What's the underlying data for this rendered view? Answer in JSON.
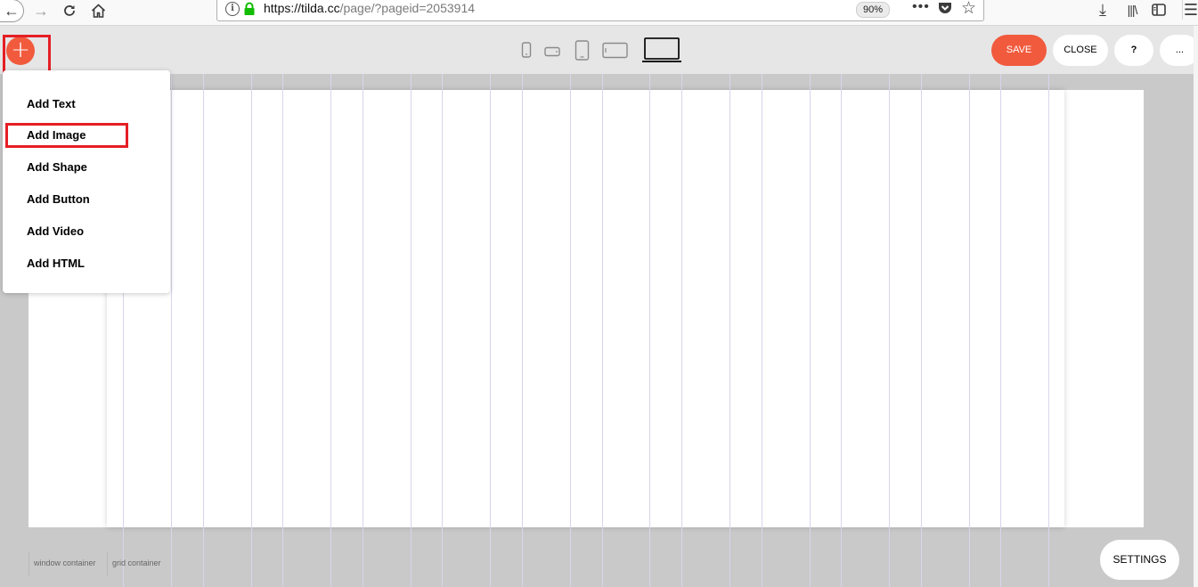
{
  "browser": {
    "url_domain": "https://tilda.cc",
    "url_path": "/page/?pageid=2053914",
    "zoom": "90%",
    "more_glyph": "•••"
  },
  "toolbar": {
    "add_glyph": "+",
    "save_label": "SAVE",
    "close_label": "CLOSE",
    "help_label": "?",
    "more_label": "..."
  },
  "add_menu": {
    "items": [
      "Add Text",
      "Add Image",
      "Add Shape",
      "Add Button",
      "Add Video",
      "Add HTML"
    ]
  },
  "footer": {
    "window_container_label": "window container",
    "grid_container_label": "grid container",
    "settings_label": "SETTINGS"
  },
  "colors": {
    "accent": "#f15a3d",
    "highlight": "#e51e25",
    "workspace": "#c9c9c9",
    "toolbar": "#e6e6e6",
    "grid_line": "#d6d6ec"
  },
  "icons": {
    "devices": [
      "mobile-portrait-icon",
      "mobile-landscape-icon",
      "tablet-portrait-icon",
      "tablet-landscape-icon",
      "laptop-icon"
    ],
    "selected_device": "laptop-icon"
  }
}
